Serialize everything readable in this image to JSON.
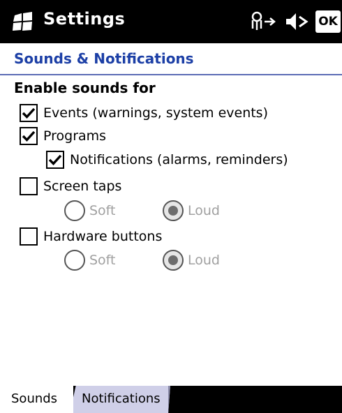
{
  "title_bar": {
    "title": "Settings",
    "ok_label": "OK",
    "start_icon": "windows-flag-icon",
    "connectivity_icon": "connectivity-icon",
    "volume_icon": "speaker-muted-icon"
  },
  "page": {
    "subtitle": "Sounds & Notifications",
    "section_heading": "Enable sounds for"
  },
  "options": {
    "events": {
      "label": "Events (warnings, system events)",
      "checked": true
    },
    "programs": {
      "label": "Programs",
      "checked": true
    },
    "notifications": {
      "label": "Notifications (alarms, reminders)",
      "checked": true
    },
    "screen_taps": {
      "label": "Screen taps",
      "checked": false,
      "soft_label": "Soft",
      "loud_label": "Loud",
      "selected": "Loud"
    },
    "hardware_buttons": {
      "label": "Hardware buttons",
      "checked": false,
      "soft_label": "Soft",
      "loud_label": "Loud",
      "selected": "Loud"
    }
  },
  "tabs": [
    {
      "label": "Sounds",
      "active": true
    },
    {
      "label": "Notifications",
      "active": false
    }
  ],
  "colors": {
    "title_bar_bg": "#000000",
    "subtitle_text": "#1c3fa6",
    "subtitle_rule": "#5b6bb5",
    "disabled_text": "#a0a0a0",
    "inactive_tab_bg": "#cfcfe8"
  }
}
